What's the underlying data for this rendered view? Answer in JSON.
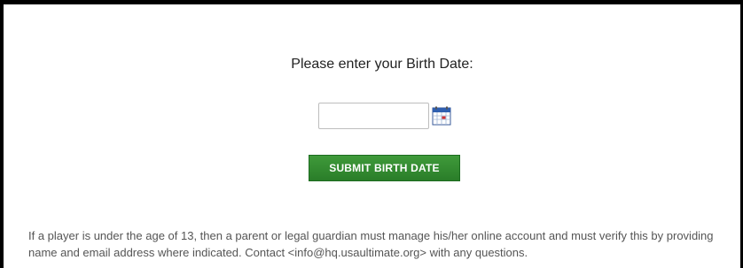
{
  "birthdate_form": {
    "prompt": "Please enter your Birth Date:",
    "date_value": "",
    "calendar_icon": "calendar-icon",
    "submit_label": "SUBMIT BIRTH DATE",
    "notice": "If a player is under the age of 13, then a parent or legal guardian must manage his/her online account and must verify this by providing name and email address where indicated. Contact <info@hq.usaultimate.org> with any questions."
  },
  "colors": {
    "button_green": "#2e8a2c",
    "button_border": "#1c6b1f",
    "text_dark": "#222222",
    "text_muted": "#555555"
  }
}
